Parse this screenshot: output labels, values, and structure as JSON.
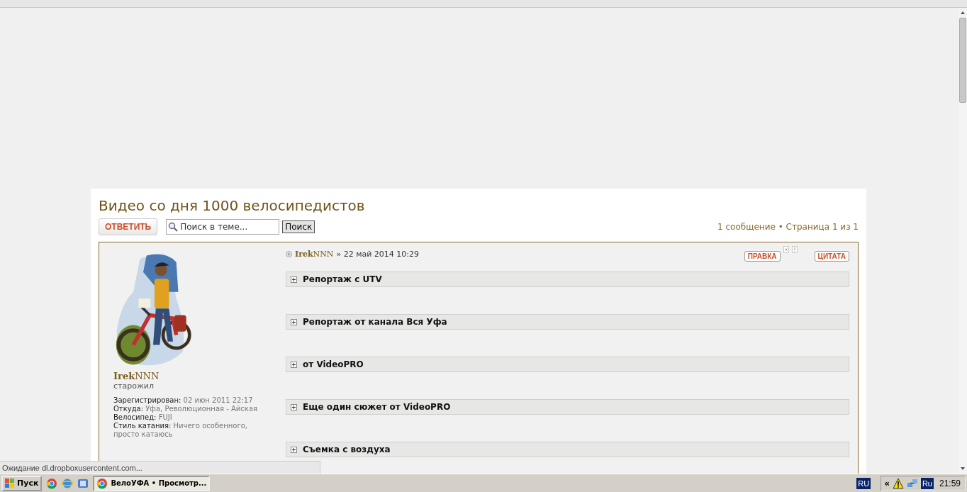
{
  "topic": {
    "title": "Видео со дня 1000 велосипедистов",
    "reply_button": "ОТВЕТИТЬ",
    "search_placeholder": "Поиск в теме...",
    "search_button": "Поиск",
    "pagination": "1 сообщение • Страница 1 из 1"
  },
  "post": {
    "author": "**Irek**NNN",
    "date": "» 22 май 2014 10:29",
    "edit_button": "ПРАВКА",
    "quote_button": "ЦИТАТА",
    "profile_name": "**Irek**NNN",
    "rank": "старожил",
    "profile": [
      {
        "label": "Зарегистрирован:",
        "value": "02 июн 2011 22:17"
      },
      {
        "label": "Откуда:",
        "value": "Уфа, Революционная - Айская"
      },
      {
        "label": "Велосипед:",
        "value": "FUJI"
      },
      {
        "label": "Стиль катания:",
        "value": "Ничего особенного, просто катаюсь"
      }
    ],
    "spoilers": [
      {
        "title": "Репортаж с UTV",
        "expanded": false
      },
      {
        "title": "Репортаж от канала Вся Уфа",
        "expanded": false
      },
      {
        "title": "от VideoPRO",
        "expanded": false
      },
      {
        "title": "Еще один сюжет от VideoPRO",
        "expanded": false
      },
      {
        "title": "Съемка с воздуха",
        "expanded": false
      }
    ]
  },
  "status_bar": {
    "text": "Ожидание dl.dropboxusercontent.com..."
  },
  "taskbar": {
    "start": "Пуск",
    "window": "ВелоУФА • Просмотр...",
    "language": "RU",
    "tray_collapse": "«",
    "tray_language": "Ru",
    "time": "21:59"
  }
}
